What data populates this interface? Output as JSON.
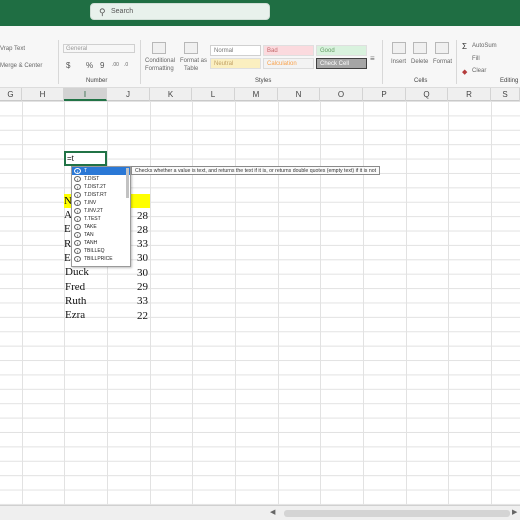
{
  "titlebar": {
    "search_placeholder": "Search",
    "left_fragment": "o"
  },
  "ribbon": {
    "wrap_text": "Vrap Text",
    "merge_center": "Merge & Center",
    "number_format": "General",
    "currency": "$",
    "percent": "%",
    "comma": "9",
    "decimals_inc": ".00",
    "decimals_dec": ".0",
    "conditional_formatting": [
      "Conditional",
      "Formatting"
    ],
    "format_as_table": [
      "Format as",
      "Table"
    ],
    "styles": {
      "normal": "Normal",
      "bad": "Bad",
      "good": "Good",
      "neutral": "Neutral",
      "calculation": "Calculation",
      "check_cell": "Check Cell"
    },
    "insert": "Insert",
    "delete": "Delete",
    "format": "Format",
    "autosum": "AutoSum",
    "fill": "Fill",
    "clear": "Clear",
    "group_number": "Number",
    "group_styles": "Styles",
    "group_cells": "Cells",
    "group_editing": "Editing"
  },
  "columns": [
    "G",
    "H",
    "I",
    "J",
    "K",
    "L",
    "M",
    "N",
    "O",
    "P",
    "Q",
    "R",
    "S"
  ],
  "active_cell_formula": "=t",
  "cells": {
    "names": [
      "A",
      "E",
      "R",
      "E",
      "Duck",
      "Fred",
      "Ruth",
      "Ezra"
    ],
    "header_fragment": "N",
    "values": [
      "28",
      "28",
      "33",
      "30",
      "30",
      "29",
      "33",
      "22"
    ]
  },
  "autocomplete": {
    "items": [
      "T",
      "T.DIST",
      "T.DIST.2T",
      "T.DIST.RT",
      "T.INV",
      "T.INV.2T",
      "T.TEST",
      "TAKE",
      "TAN",
      "TANH",
      "TBILLEQ",
      "TBILLPRICE"
    ],
    "selected_index": 0
  },
  "tooltip": "Checks whether a value is text, and returns the text if it is, or returns double quotes (empty text) if it is not",
  "colors": {
    "excel_green": "#217346",
    "highlight_yellow": "#ffff00",
    "selection_blue": "#2a78d6"
  }
}
